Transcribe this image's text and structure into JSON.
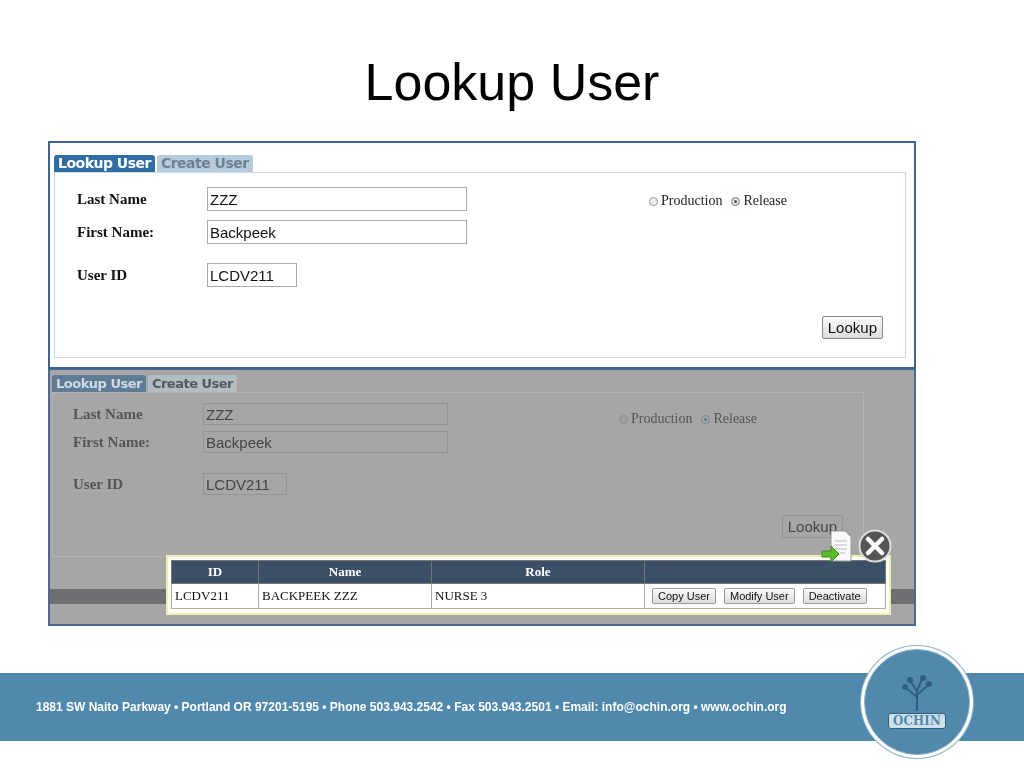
{
  "title": "Lookup User",
  "forms": [
    {
      "dimmed": false,
      "tabs": [
        {
          "label": "Lookup User",
          "selected": true
        },
        {
          "label": "Create User",
          "selected": false
        }
      ],
      "fields": [
        {
          "label": "Last Name",
          "value": "ZZZ"
        },
        {
          "label": "First Name:",
          "value": "Backpeek"
        },
        {
          "label": "User ID",
          "value": "LCDV211"
        }
      ],
      "environments": [
        {
          "label": "Production",
          "selected": false
        },
        {
          "label": "Release",
          "selected": true
        }
      ],
      "lookup_button": "Lookup"
    },
    {
      "dimmed": true,
      "tabs": [
        {
          "label": "Lookup User",
          "selected": true
        },
        {
          "label": "Create User",
          "selected": false
        }
      ],
      "fields": [
        {
          "label": "Last Name",
          "value": "ZZZ"
        },
        {
          "label": "First Name:",
          "value": "Backpeek"
        },
        {
          "label": "User ID",
          "value": "LCDV211"
        }
      ],
      "environments": [
        {
          "label": "Production",
          "selected": false
        },
        {
          "label": "Release",
          "selected": true
        }
      ],
      "lookup_button": "Lookup"
    }
  ],
  "results": {
    "columns": [
      "ID",
      "Name",
      "Role",
      ""
    ],
    "rows": [
      {
        "cells": [
          "LCDV211",
          "BACKPEEK ZZZ",
          "NURSE 3"
        ],
        "actions": [
          "Copy User",
          "Modify User",
          "Deactivate"
        ]
      }
    ]
  },
  "footer": {
    "contact": "1881 SW Naito Parkway • Portland OR 97201-5195 • Phone 503.943.2542 • Fax 503.943.2501 • Email: info@ochin.org • www.ochin.org",
    "logo_text": "OCHIN"
  }
}
